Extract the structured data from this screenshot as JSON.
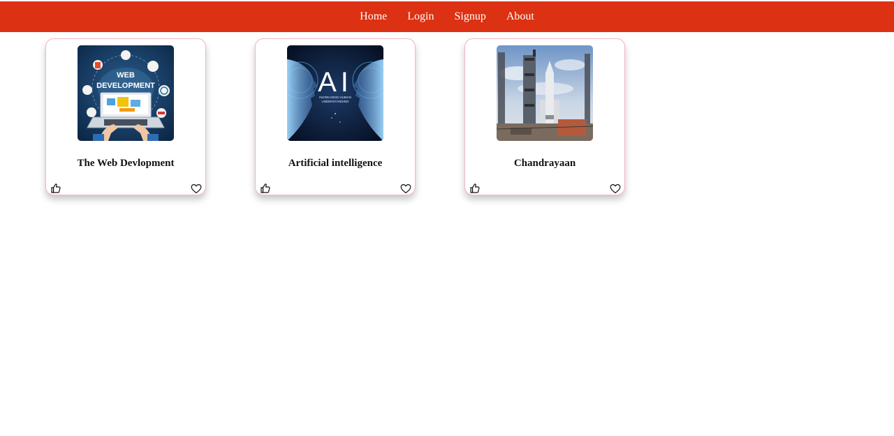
{
  "nav": {
    "items": [
      {
        "label": "Home"
      },
      {
        "label": "Login"
      },
      {
        "label": "Signup"
      },
      {
        "label": "About"
      }
    ],
    "bar_color": "#dc3112"
  },
  "cards": [
    {
      "title": "The Web Devlopment",
      "image": {
        "caption_line1": "WEB",
        "caption_line2": "DEVELOPMENT",
        "badges": [
          "php",
          "html5",
          "wordpress",
          "java",
          "js",
          "angular"
        ]
      },
      "like_icon": "thumbs-up-icon",
      "heart_icon": "heart-icon"
    },
    {
      "title": "Artificial intelligence",
      "image": {
        "caption_line1": "AI",
        "caption_line2": "INCREASING HUMAN",
        "caption_line3": "UNDERSTANDING"
      },
      "like_icon": "thumbs-up-icon",
      "heart_icon": "heart-icon"
    },
    {
      "title": "Chandrayaan",
      "like_icon": "thumbs-up-icon",
      "heart_icon": "heart-icon"
    }
  ],
  "colors": {
    "card_border": "#f2b5c7",
    "title_text": "#111111"
  }
}
